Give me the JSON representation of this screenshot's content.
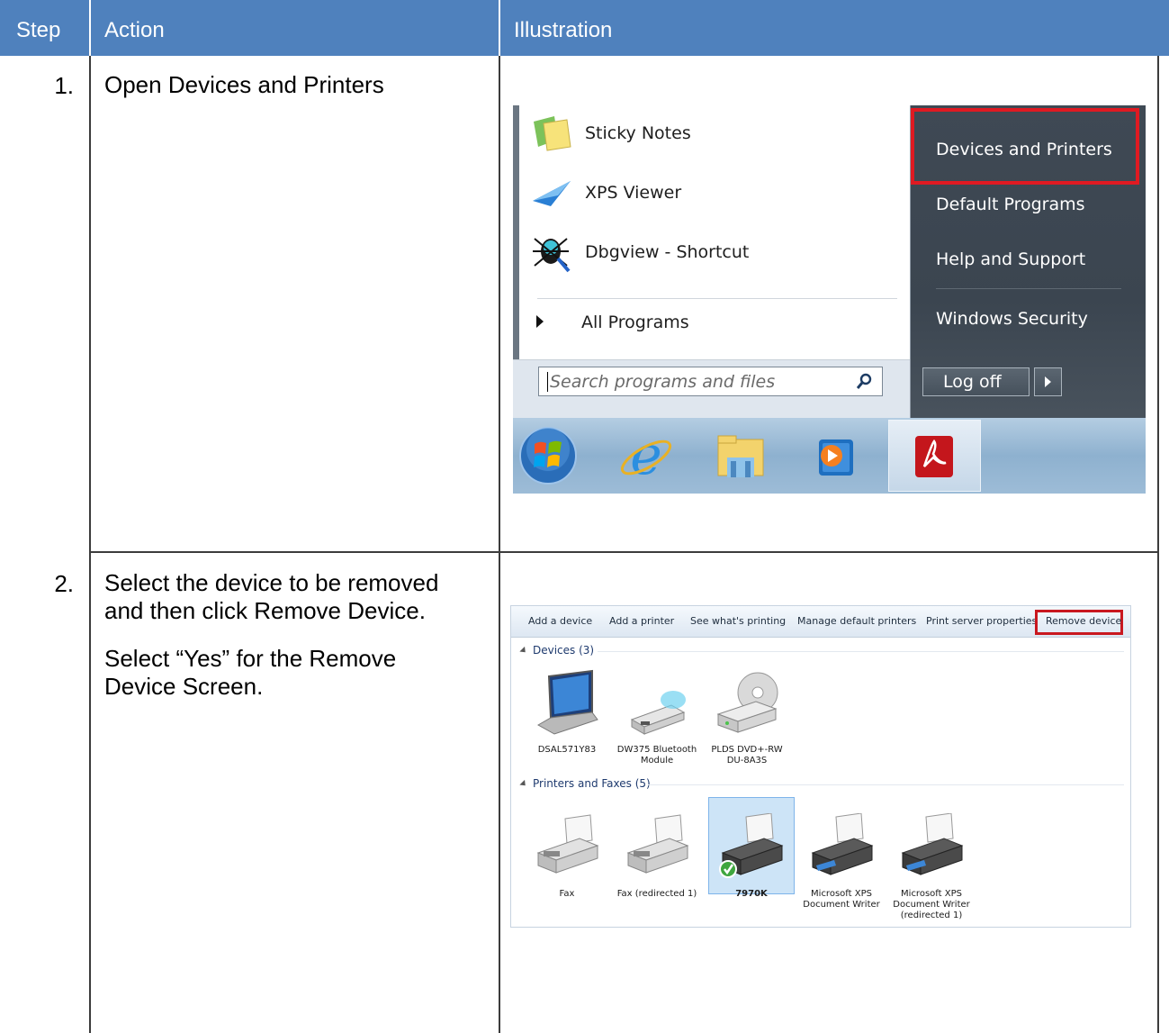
{
  "table": {
    "headers": {
      "step": "Step",
      "action": "Action",
      "illustration": "Illustration"
    },
    "header_color": "#4f81bd",
    "rows": [
      {
        "num": "1.",
        "lines": [
          "Open Devices and Printers"
        ]
      },
      {
        "num": "2.",
        "lines": [
          "Select the device to be removed",
          "and then click Remove Device.",
          "Select “Yes” for the Remove",
          "Device Screen."
        ]
      }
    ]
  },
  "start_menu": {
    "programs": [
      {
        "label": "Sticky Notes",
        "icon": "sticky-notes-icon"
      },
      {
        "label": "XPS Viewer",
        "icon": "xps-viewer-icon"
      },
      {
        "label": "Dbgview - Shortcut",
        "icon": "dbgview-icon"
      }
    ],
    "all_programs": "All Programs",
    "search_placeholder": "Search programs and files",
    "right_items": [
      "Devices and Printers",
      "Default Programs",
      "Help and Support",
      "Windows Security"
    ],
    "log_off": "Log off",
    "highlight_color": "#e01a22",
    "taskbar": [
      "start-orb-icon",
      "internet-explorer-icon",
      "windows-explorer-icon",
      "media-player-icon",
      "adobe-reader-icon"
    ]
  },
  "devices_printers": {
    "toolbar": [
      "Add a device",
      "Add a printer",
      "See what's printing",
      "Manage default printers",
      "Print server properties",
      "Remove device"
    ],
    "devices_group": "Devices (3)",
    "devices": [
      {
        "name1": "DSAL571Y83",
        "name2": ""
      },
      {
        "name1": "DW375 Bluetooth",
        "name2": "Module"
      },
      {
        "name1": "PLDS DVD+-RW",
        "name2": "DU-8A3S"
      }
    ],
    "printers_group": "Printers and Faxes (5)",
    "printers": [
      {
        "name1": "Fax",
        "name2": "",
        "name3": ""
      },
      {
        "name1": "Fax (redirected 1)",
        "name2": "",
        "name3": ""
      },
      {
        "name1": "7970K",
        "name2": "",
        "name3": ""
      },
      {
        "name1": "Microsoft XPS",
        "name2": "Document Writer",
        "name3": ""
      },
      {
        "name1": "Microsoft XPS",
        "name2": "Document Writer",
        "name3": "(redirected 1)"
      }
    ]
  }
}
